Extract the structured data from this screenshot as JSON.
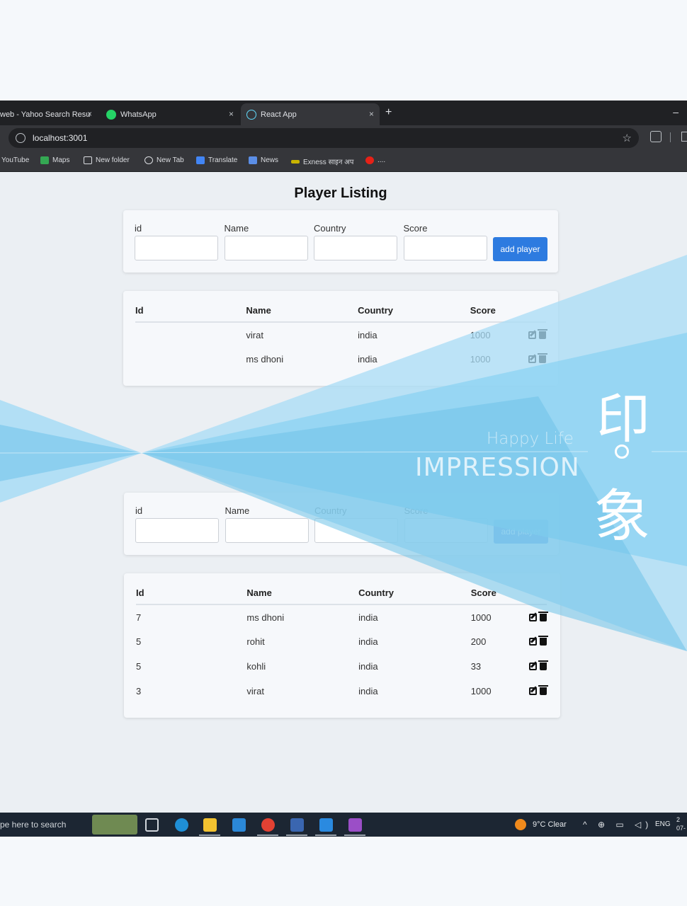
{
  "browser": {
    "tabs": [
      {
        "title": "web - Yahoo Search Resu",
        "close": "×"
      },
      {
        "title": "WhatsApp",
        "close": "×"
      },
      {
        "title": "React App",
        "close": "×"
      }
    ],
    "new_tab": "+",
    "minimize": "–",
    "url": "localhost:3001",
    "bookmark_star": "☆",
    "bookmarks": [
      "YouTube",
      "Maps",
      "New folder",
      "New Tab",
      "Translate",
      "News",
      "Exness साइन अप",
      "...."
    ]
  },
  "page": {
    "title": "Player Listing",
    "form_labels": {
      "id": "id",
      "name": "Name",
      "country": "Country",
      "score": "Score"
    },
    "add_button": "add player",
    "table_headers": {
      "id": "Id",
      "name": "Name",
      "country": "Country",
      "score": "Score"
    },
    "table1_rows": [
      {
        "id": "",
        "name": "virat",
        "country": "india",
        "score": "1000"
      },
      {
        "id": "",
        "name": "ms dhoni",
        "country": "india",
        "score": "1000"
      }
    ],
    "table2_rows": [
      {
        "id": "7",
        "name": "ms dhoni",
        "country": "india",
        "score": "1000"
      },
      {
        "id": "5",
        "name": "rohit",
        "country": "india",
        "score": "200"
      },
      {
        "id": "5",
        "name": "kohli",
        "country": "india",
        "score": "33"
      },
      {
        "id": "3",
        "name": "virat",
        "country": "india",
        "score": "1000"
      }
    ]
  },
  "taskbar": {
    "search_text": "pe here to search",
    "weather": "9°C  Clear",
    "tray": "^ ⊕ ▭ ◁)",
    "language": "ENG",
    "clock": "2\n07-"
  },
  "overlay": {
    "happy_life": "Happy Life",
    "impression": "IMPRESSION",
    "cjk_top": "印",
    "cjk_bottom": "象"
  },
  "colors": {
    "accent": "#2d7be0",
    "overlay_light": "#a8dcf5",
    "overlay_mid": "#6fc3e8"
  }
}
